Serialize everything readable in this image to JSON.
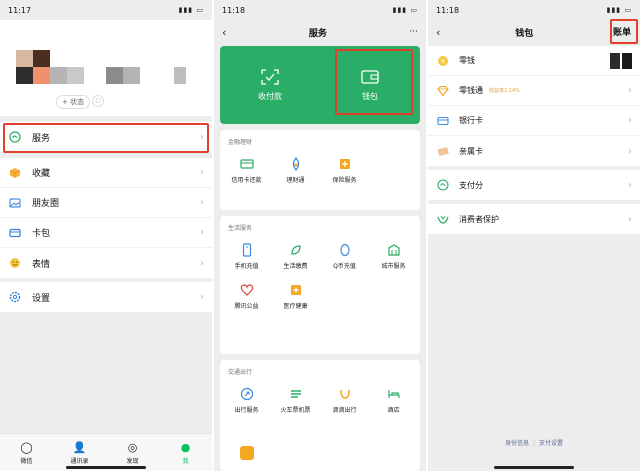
{
  "colors": {
    "wechat_green": "#07c160",
    "service_green": "#2aae67",
    "highlight_red": "#e0402c"
  },
  "screen_me": {
    "time": "11:17",
    "status_chip": "+ 状态",
    "menu_services": "服务",
    "menu_favorites": "收藏",
    "menu_moments": "朋友圈",
    "menu_cards": "卡包",
    "menu_stickers": "表情",
    "menu_settings": "设置",
    "tabs": [
      "微信",
      "通讯录",
      "发现",
      "我"
    ]
  },
  "screen_services": {
    "time": "11:18",
    "title": "服务",
    "more": "···",
    "pay_label": "收付款",
    "wallet_label": "钱包",
    "finance": {
      "title": "金融理财",
      "items": [
        "信用卡还款",
        "理财通",
        "保险服务"
      ]
    },
    "life": {
      "title": "生活服务",
      "items": [
        "手机充值",
        "生活缴费",
        "Q币充值",
        "城市服务",
        "腾讯公益",
        "医疗健康"
      ]
    },
    "travel": {
      "title": "交通出行",
      "items": [
        "出行服务",
        "火车票机票",
        "滴滴出行",
        "酒店"
      ]
    }
  },
  "screen_wallet": {
    "time": "11:18",
    "title": "钱包",
    "bill": "账单",
    "items": {
      "change": "零钱",
      "change_plus": "零钱通",
      "yield_note": "收益率2.14%",
      "bank_card": "银行卡",
      "family_card": "亲属卡",
      "pay_score": "支付分",
      "consumer_protection": "消费者保护"
    },
    "footer": {
      "identity": "身份信息",
      "sep": "|",
      "pay_settings": "支付设置"
    }
  }
}
